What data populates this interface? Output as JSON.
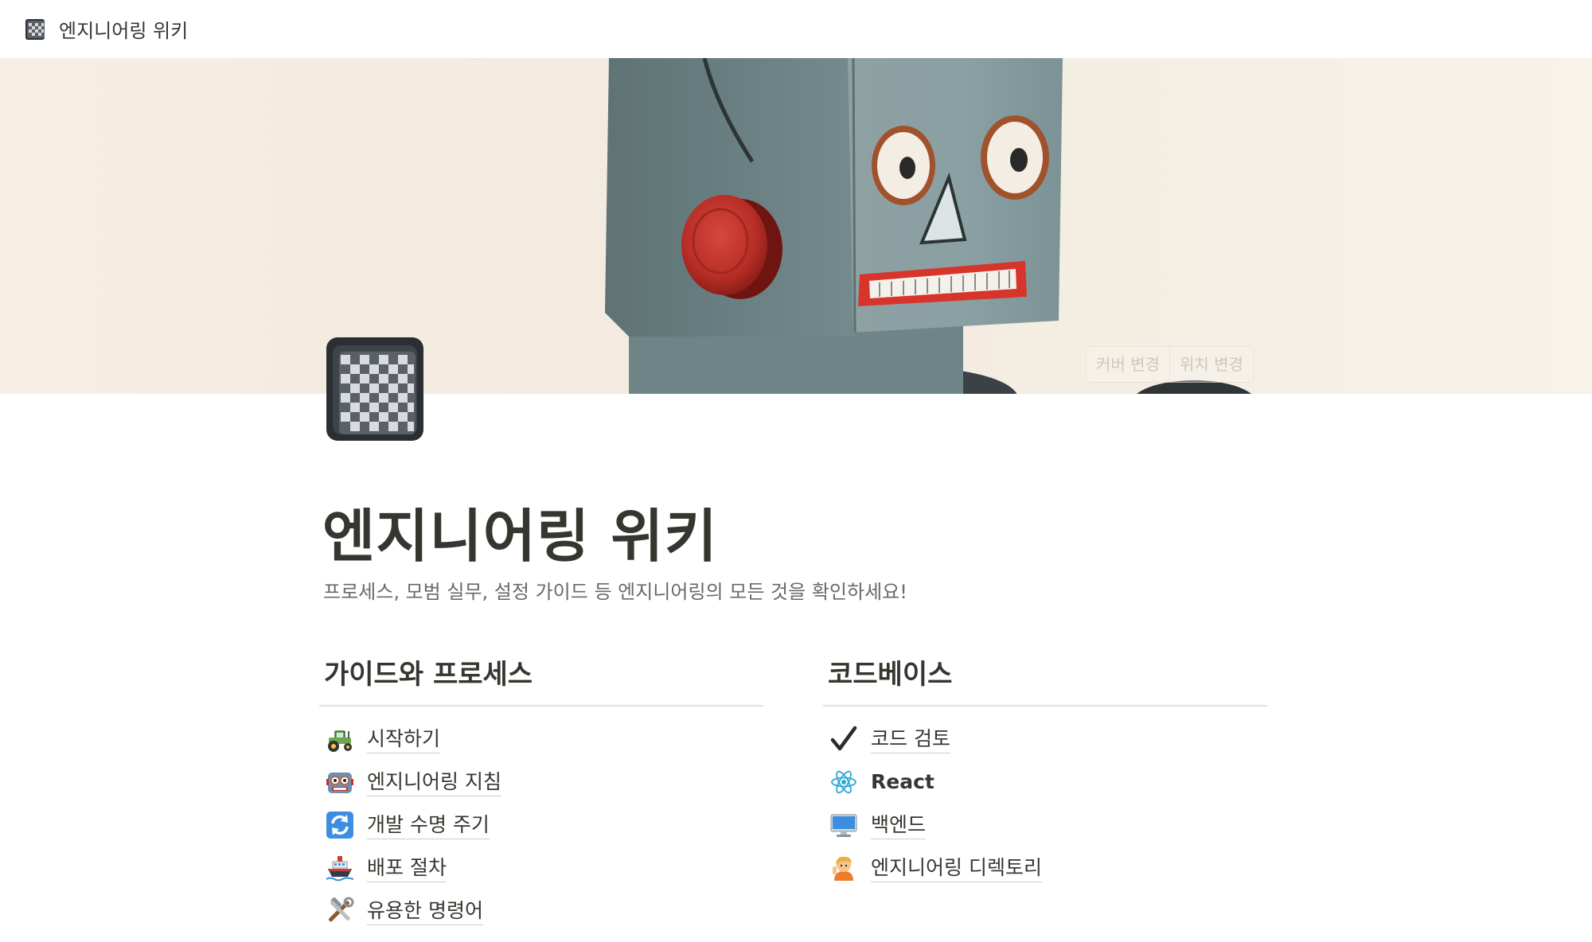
{
  "topbar": {
    "title": "엔지니어링 위키",
    "icon": "notebook-icon"
  },
  "cover": {
    "change_cover_label": "커버 변경",
    "reposition_label": "위치 변경"
  },
  "page": {
    "icon": "notebook-icon",
    "title": "엔지니어링 위키",
    "description": "프로세스, 모범 실무, 설정 가이드 등 엔지니어링의 모든 것을 확인하세요!"
  },
  "columns": [
    {
      "heading": "가이드와 프로세스",
      "links": [
        {
          "icon": "tractor-icon",
          "label": "시작하기"
        },
        {
          "icon": "robot-icon",
          "label": "엔지니어링 지침"
        },
        {
          "icon": "refresh-icon",
          "label": "개발 수명 주기"
        },
        {
          "icon": "ship-icon",
          "label": "배포 절차"
        },
        {
          "icon": "tools-icon",
          "label": "유용한 명령어"
        }
      ]
    },
    {
      "heading": "코드베이스",
      "links": [
        {
          "icon": "checkmark-icon",
          "label": "코드 검토"
        },
        {
          "icon": "react-icon",
          "label": "React"
        },
        {
          "icon": "desktop-icon",
          "label": "백엔드"
        },
        {
          "icon": "person-icon",
          "label": "엔지니어링 디렉토리"
        }
      ]
    }
  ],
  "colors": {
    "text": "#37352f",
    "muted": "#6b6963",
    "divider": "#e4e3e0",
    "robot_body": "#7f9597",
    "robot_button": "#c8322a"
  }
}
